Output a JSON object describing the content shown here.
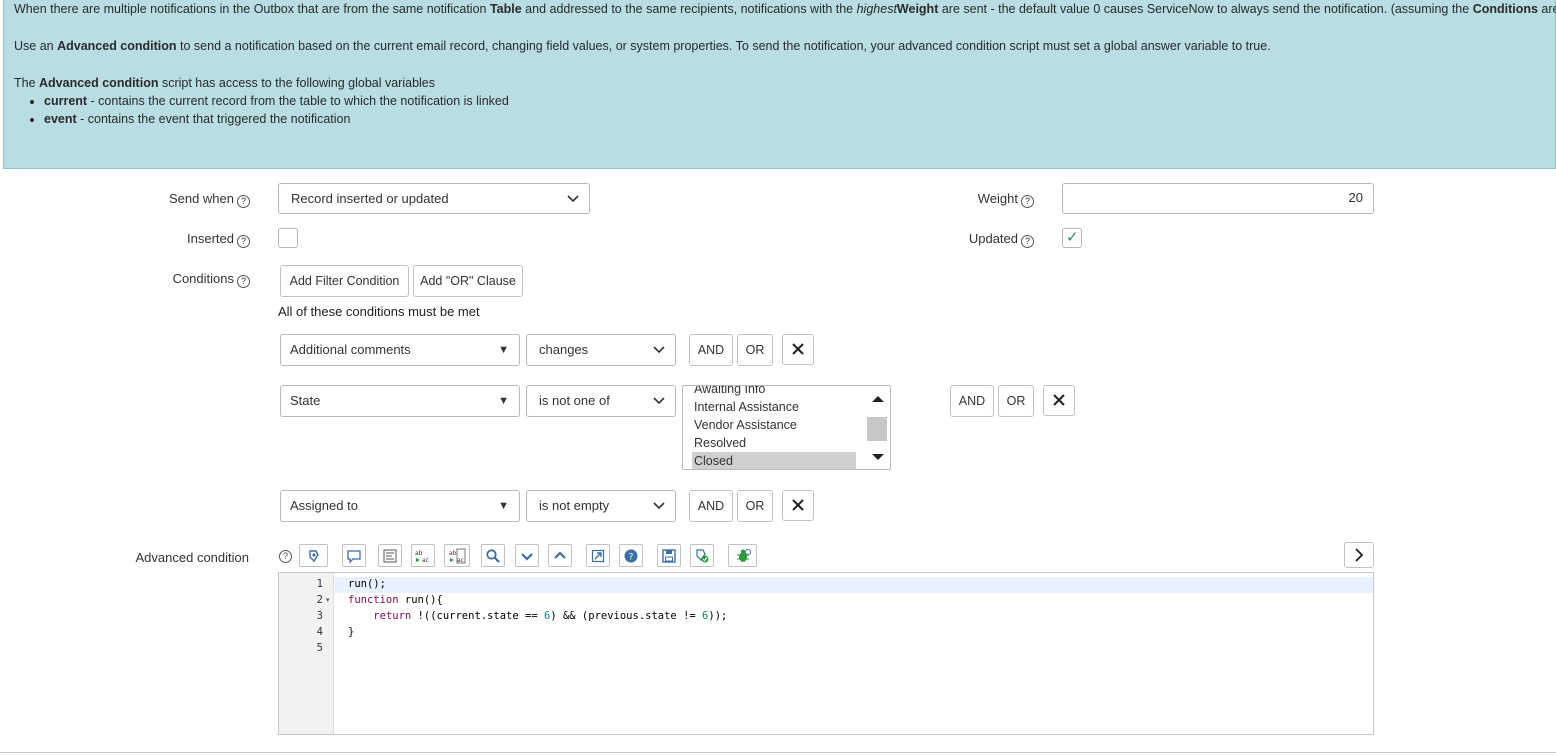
{
  "info": {
    "line1_a": "When there are multiple notifications in the Outbox that are from the same notification ",
    "line1_b": "Table",
    "line1_c": " and addressed to the same recipients, notifications with the ",
    "line1_d": "highest",
    "line1_e": "Weight",
    "line1_f": " are sent - the default value 0 causes ServiceNow to always send the notification. (assuming the ",
    "line1_g": "Conditions",
    "line1_h": " are met)",
    "line2_a": "Use an ",
    "line2_b": "Advanced condition",
    "line2_c": " to send a notification based on the current email record, changing field values, or system properties. To send the notification, your advanced condition script must set a global answer variable to true.",
    "line3_a": "The ",
    "line3_b": "Advanced condition",
    "line3_c": " script has access to the following global variables",
    "bullets": [
      {
        "term": "current",
        "desc": " - contains the current record from the table to which the notification is linked"
      },
      {
        "term": "event",
        "desc": " - contains the event that triggered the notification"
      }
    ]
  },
  "form": {
    "send_when_label": "Send when",
    "send_when_value": "Record inserted or updated",
    "weight_label": "Weight",
    "weight_value": "20",
    "inserted_label": "Inserted",
    "updated_label": "Updated",
    "conditions_label": "Conditions",
    "add_filter_label": "Add Filter Condition",
    "add_or_label": "Add \"OR\" Clause",
    "all_conditions_text": "All of these conditions must be met",
    "advanced_label": "Advanced condition"
  },
  "conditions": [
    {
      "field": "Additional comments",
      "operator": "changes"
    },
    {
      "field": "State",
      "operator": "is not one of",
      "options": [
        "Awaiting Info",
        "Internal Assistance",
        "Vendor Assistance",
        "Resolved",
        "Closed"
      ],
      "selected": "Closed"
    },
    {
      "field": "Assigned to",
      "operator": "is not empty"
    }
  ],
  "buttons": {
    "and": "AND",
    "or": "OR"
  },
  "editor": {
    "line_numbers": [
      "1",
      "2",
      "3",
      "4",
      "5"
    ],
    "lines": [
      "run();",
      "function run(){",
      "    return !((current.state == 6) && (previous.state != 6));",
      "}",
      ""
    ]
  },
  "icons": {
    "help": "?",
    "chevron": "⌵",
    "triangle": "▼",
    "close": "✕",
    "check": "✓",
    "expand": ">"
  }
}
